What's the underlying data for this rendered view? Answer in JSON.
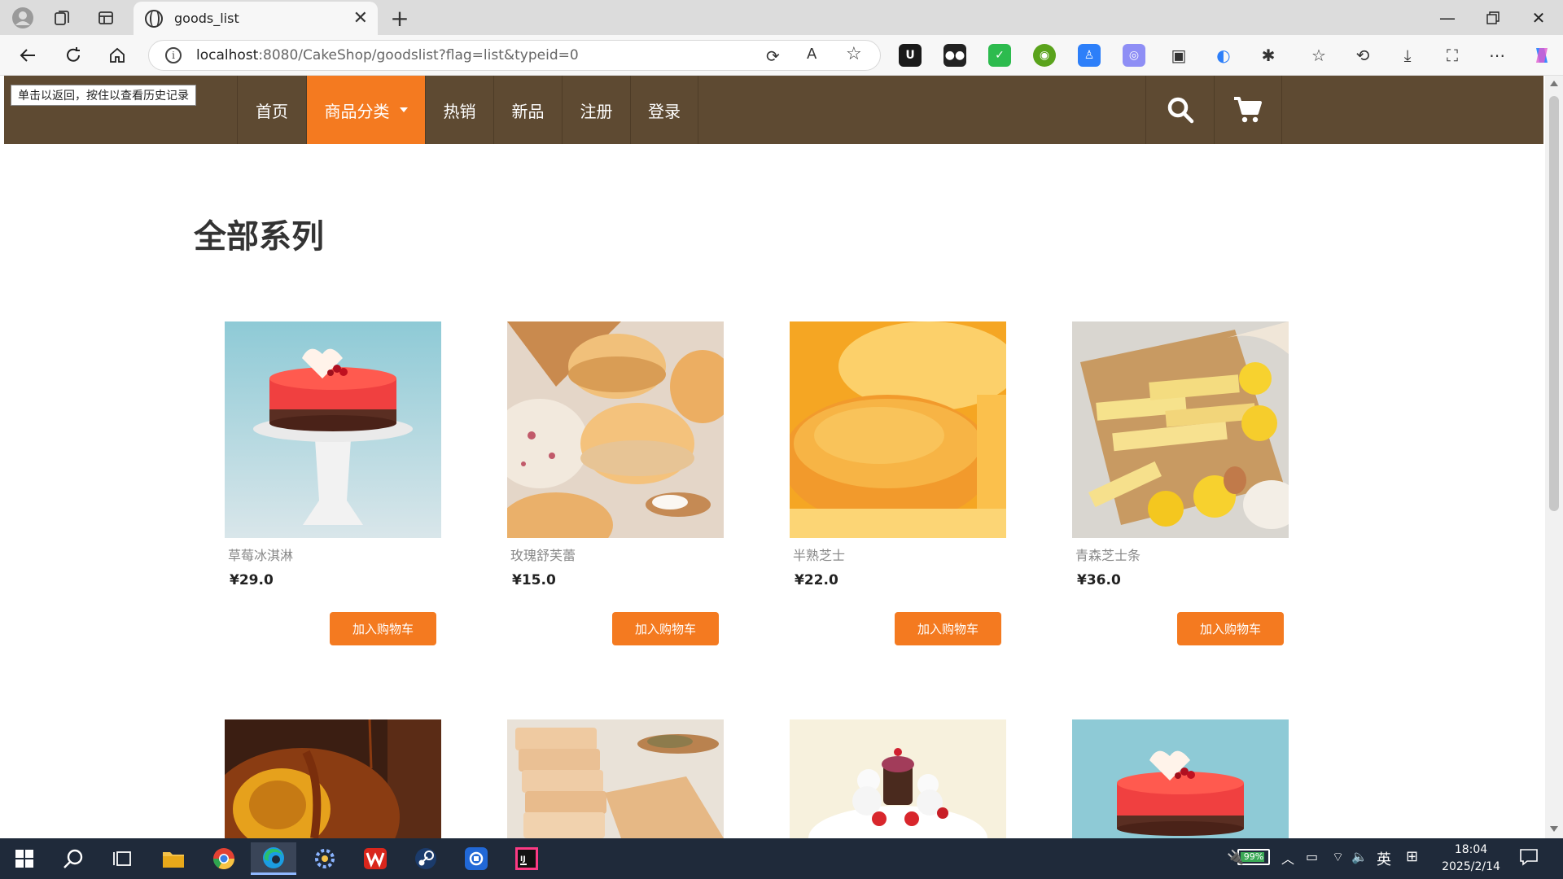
{
  "browser": {
    "tab_title": "goods_list",
    "url_host": "localhost",
    "url_rest": ":8080/CakeShop/goodslist?flag=list&typeid=0",
    "tooltip": "单击以返回，按住以查看历史记录"
  },
  "nav": {
    "items": [
      {
        "label": "首页"
      },
      {
        "label": "商品分类",
        "active": true,
        "has_dropdown": true
      },
      {
        "label": "热销"
      },
      {
        "label": "新品"
      },
      {
        "label": "注册"
      },
      {
        "label": "登录"
      }
    ],
    "icons": [
      "search-icon",
      "cart-icon"
    ],
    "colors": {
      "bar": "#5e4a32",
      "active": "#f47a20"
    }
  },
  "page": {
    "title": "全部系列"
  },
  "products": [
    {
      "name": "草莓冰淇淋",
      "price": "¥29.0",
      "button": "加入购物车",
      "image": "strawberry-cake"
    },
    {
      "name": "玫瑰舒芙蕾",
      "price": "¥15.0",
      "button": "加入购物车",
      "image": "souffle-buns"
    },
    {
      "name": "半熟芝士",
      "price": "¥22.0",
      "button": "加入购物车",
      "image": "half-baked-cheese"
    },
    {
      "name": "青森芝士条",
      "price": "¥36.0",
      "button": "加入购物车",
      "image": "cheese-bars-lemon"
    },
    {
      "name": "",
      "price": "",
      "button": "",
      "image": "caramel-bundt-cake"
    },
    {
      "name": "",
      "price": "",
      "button": "",
      "image": "crisp-biscuits"
    },
    {
      "name": "",
      "price": "",
      "button": "",
      "image": "cat-cake"
    },
    {
      "name": "",
      "price": "",
      "button": "",
      "image": "strawberry-cake"
    }
  ],
  "taskbar": {
    "battery": "99%",
    "ime": "英",
    "time": "18:04",
    "date": "2025/2/14"
  }
}
